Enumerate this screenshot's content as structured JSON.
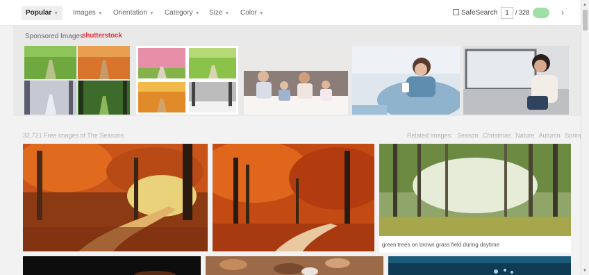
{
  "filters": {
    "popular": "Popular",
    "images": "Images",
    "orientation": "Orientation",
    "category": "Category",
    "size": "Size",
    "color": "Color"
  },
  "safesearch": {
    "label": "SafeSearch",
    "checked": false
  },
  "pagination": {
    "current": "1",
    "total": "/ 328",
    "next_icon": "chevron-right-icon"
  },
  "sponsored": {
    "label": "Sponsored Images",
    "brand": "shutterstock"
  },
  "results": {
    "count_text": "32,721 Free images of The Seasons",
    "related_label": "Related Images:",
    "related": [
      "Season",
      "Christmas",
      "Nature",
      "Autumn",
      "Spring"
    ]
  },
  "photos": [
    {
      "caption": ""
    },
    {
      "caption": ""
    },
    {
      "caption": "green trees on brown grass field during daytime"
    }
  ],
  "colors": {
    "accent_green": "#9fe0a6",
    "brand_red": "#e8353b"
  }
}
